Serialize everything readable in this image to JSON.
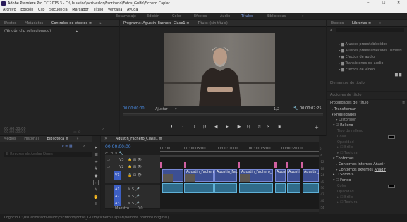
{
  "window": {
    "title": "Adobe Premiere Pro CC 2015.3 - C:\\Usuarios\\acriveslor\\Escritorio\\Fotos_Gulfo\\Fichero Caplar",
    "minimize": "–",
    "maximize": "☐",
    "close": "✕"
  },
  "menu": [
    "Archivo",
    "Edición",
    "Clip",
    "Secuencia",
    "Marcador",
    "Título",
    "Ventana",
    "Ayuda"
  ],
  "workspaces": [
    "Ensamblaje",
    "Edición",
    "Color",
    "Efectos",
    "Audio",
    "Títulos",
    "Bibliotecas",
    "»"
  ],
  "source_panel": {
    "tabs": [
      "Efectos",
      "Metadatos",
      "Controles de efectos ≡",
      "▸"
    ],
    "clip_label": "(Ningún clip seleccionado)",
    "timecode": "00:00:00:00"
  },
  "program_panel": {
    "title": "Programa: Agustin_Fachero_Clase1 ≡",
    "title2": "Título: (sin título)",
    "timecode_left": "00:00:00:00",
    "fit": "Ajustar",
    "ratio": "1/2",
    "timecode_right": "00:00:02:25",
    "transport": [
      "⏴",
      "{",
      "}",
      "|⏴",
      "◀|",
      "◀",
      "▶",
      "|▶",
      "⏵|",
      "⎘",
      "⎘",
      "▣"
    ],
    "add": "+"
  },
  "project_panel": {
    "tabs": [
      "Efectos",
      "Librerías ≡",
      "»"
    ],
    "search_placeholder": "",
    "folders": [
      "Ajustes preestablecidos",
      "Ajustes preestablecidos Lumetri",
      "Efectos de audio",
      "Transiciones de audio",
      "Efectos de vídeo"
    ],
    "section1": "Elementos de título",
    "section2": "Acciones de título"
  },
  "title_props": {
    "header": "Propiedades del título",
    "items": [
      "Transformar",
      "Propiedades",
      "Distorsión",
      "Relleno",
      "Tipo de relleno",
      "Color",
      "Opacidad",
      "Brillo",
      "Textura",
      "Contornos",
      "Contornos internos",
      "Contornos externos",
      "Sombra",
      "Fondo",
      "Color",
      "Opacidad",
      "Brillo",
      "Textura"
    ],
    "add_labels": [
      "Añadir",
      "Añadir"
    ]
  },
  "bottom_left": {
    "tabs": [
      "Medios",
      "Historial",
      "Biblioteca ≡",
      "»"
    ],
    "time": "00:00:00:00",
    "search_text": "El Recurso de Adobe Stock",
    "zoom": "▭ ⊙"
  },
  "timeline": {
    "tab": "Agustin_Fachero_Clase1 ≡",
    "timecode": "00:00:00:00",
    "ruler": [
      "00:00",
      "00:00:05:00",
      "00:00:10:00",
      "00:00:15:00",
      "00:00:20:00",
      "00:00:25:00"
    ],
    "video_tracks": [
      "V3",
      "V2",
      "V1"
    ],
    "audio_tracks": [
      "A1",
      "A2",
      "A3"
    ],
    "master": "Maestro",
    "master_value": "0,0",
    "clip_names": [
      "Agustin_Fachero_Clase1",
      "Agustin_Fachero_Clase1",
      "Agustin_Fachero_",
      "Agustin_Fachero_",
      "Agustin_Fachero_",
      "Agustin_Fachero_"
    ]
  },
  "vu_scale": [
    "0",
    "-6",
    "-12",
    "-18",
    "-24",
    "-30",
    "-36",
    "-42",
    "-48",
    "-54"
  ],
  "status": "Logocio C:\\Usuarios\\acriveslor\\Escritorio\\Fotos_Gulfo\\Fichero Caplar\\Nombre nombre original)"
}
